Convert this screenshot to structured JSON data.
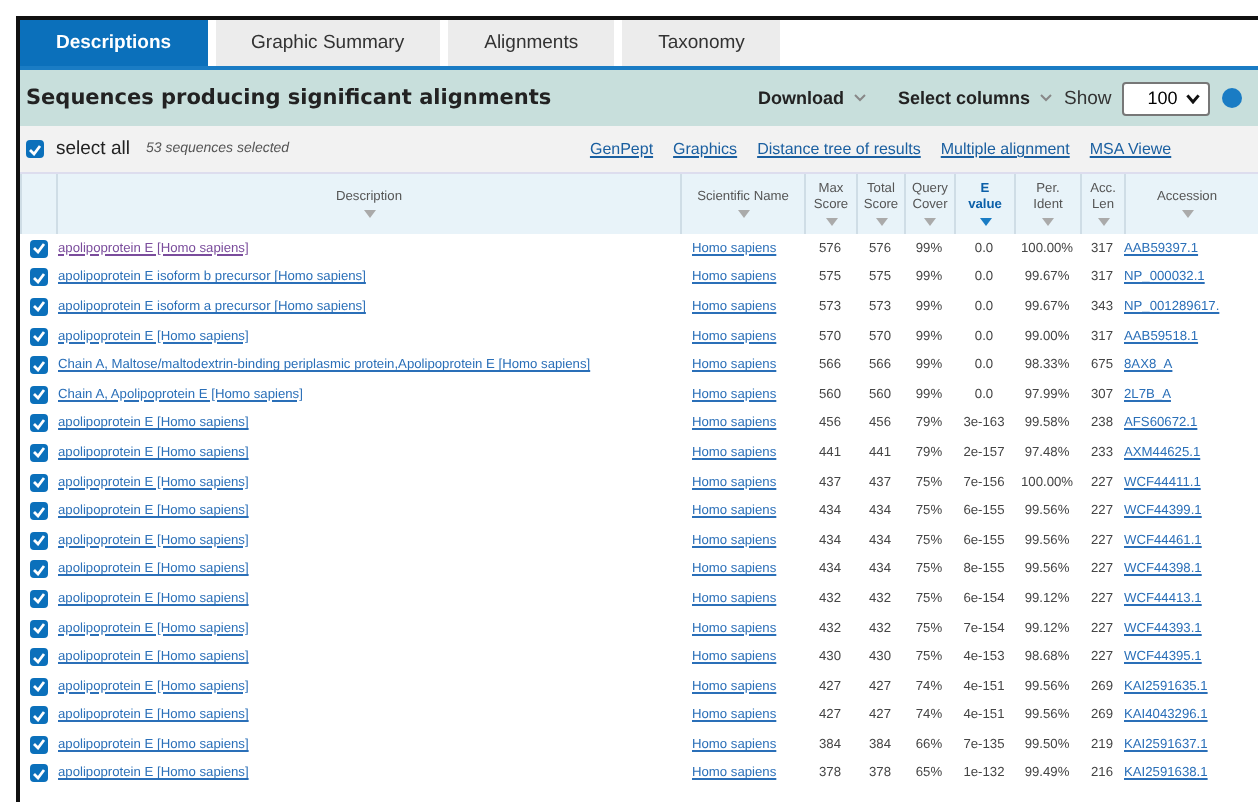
{
  "tabs": [
    {
      "label": "Descriptions",
      "selected": true
    },
    {
      "label": "Graphic Summary",
      "selected": false
    },
    {
      "label": "Alignments",
      "selected": false
    },
    {
      "label": "Taxonomy",
      "selected": false
    }
  ],
  "toolbar": {
    "title": "Sequences producing significant alignments",
    "download": "Download",
    "select_columns": "Select columns",
    "show_label": "Show",
    "show_value": "100"
  },
  "select_all": {
    "label": "select all",
    "checked": true,
    "count": "53 sequences selected"
  },
  "links": [
    "GenPept",
    "Graphics",
    "Distance tree of results",
    "Multiple alignment",
    "MSA Viewe"
  ],
  "columns": [
    {
      "label": "Description",
      "sorted": false
    },
    {
      "label": "Scientific Name",
      "sorted": false
    },
    {
      "label": "Max Score",
      "sorted": false
    },
    {
      "label": "Total Score",
      "sorted": false
    },
    {
      "label": "Query Cover",
      "sorted": false
    },
    {
      "label": "E value",
      "sorted": true
    },
    {
      "label": "Per. Ident",
      "sorted": false
    },
    {
      "label": "Acc. Len",
      "sorted": false
    },
    {
      "label": "Accession",
      "sorted": false
    }
  ],
  "rows": [
    {
      "checked": true,
      "visited": true,
      "description": "apolipoprotein E [Homo sapiens]",
      "scientific_name": "Homo sapiens",
      "max_score": "576",
      "total_score": "576",
      "query_cover": "99%",
      "e_value": "0.0",
      "per_ident": "100.00%",
      "acc_len": "317",
      "accession": "AAB59397.1"
    },
    {
      "checked": true,
      "visited": false,
      "description": "apolipoprotein E isoform b precursor [Homo sapiens]",
      "scientific_name": "Homo sapiens",
      "max_score": "575",
      "total_score": "575",
      "query_cover": "99%",
      "e_value": "0.0",
      "per_ident": "99.67%",
      "acc_len": "317",
      "accession": "NP_000032.1"
    },
    {
      "checked": true,
      "visited": false,
      "description": "apolipoprotein E isoform a precursor [Homo sapiens]",
      "scientific_name": "Homo sapiens",
      "max_score": "573",
      "total_score": "573",
      "query_cover": "99%",
      "e_value": "0.0",
      "per_ident": "99.67%",
      "acc_len": "343",
      "accession": "NP_001289617."
    },
    {
      "checked": true,
      "visited": false,
      "description": "apolipoprotein E [Homo sapiens]",
      "scientific_name": "Homo sapiens",
      "max_score": "570",
      "total_score": "570",
      "query_cover": "99%",
      "e_value": "0.0",
      "per_ident": "99.00%",
      "acc_len": "317",
      "accession": "AAB59518.1"
    },
    {
      "checked": true,
      "visited": false,
      "description": "Chain A, Maltose/maltodextrin-binding periplasmic protein,Apolipoprotein E [Homo sapiens]",
      "scientific_name": "Homo sapiens",
      "max_score": "566",
      "total_score": "566",
      "query_cover": "99%",
      "e_value": "0.0",
      "per_ident": "98.33%",
      "acc_len": "675",
      "accession": "8AX8_A"
    },
    {
      "checked": true,
      "visited": false,
      "description": "Chain A, Apolipoprotein E [Homo sapiens]",
      "scientific_name": "Homo sapiens",
      "max_score": "560",
      "total_score": "560",
      "query_cover": "99%",
      "e_value": "0.0",
      "per_ident": "97.99%",
      "acc_len": "307",
      "accession": "2L7B_A"
    },
    {
      "checked": true,
      "visited": false,
      "description": "apolipoprotein E [Homo sapiens]",
      "scientific_name": "Homo sapiens",
      "max_score": "456",
      "total_score": "456",
      "query_cover": "79%",
      "e_value": "3e-163",
      "per_ident": "99.58%",
      "acc_len": "238",
      "accession": "AFS60672.1"
    },
    {
      "checked": true,
      "visited": false,
      "description": "apolipoprotein E [Homo sapiens]",
      "scientific_name": "Homo sapiens",
      "max_score": "441",
      "total_score": "441",
      "query_cover": "79%",
      "e_value": "2e-157",
      "per_ident": "97.48%",
      "acc_len": "233",
      "accession": "AXM44625.1"
    },
    {
      "checked": true,
      "visited": false,
      "description": "apolipoprotein E [Homo sapiens]",
      "scientific_name": "Homo sapiens",
      "max_score": "437",
      "total_score": "437",
      "query_cover": "75%",
      "e_value": "7e-156",
      "per_ident": "100.00%",
      "acc_len": "227",
      "accession": "WCF44411.1"
    },
    {
      "checked": true,
      "visited": false,
      "description": "apolipoprotein E [Homo sapiens]",
      "scientific_name": "Homo sapiens",
      "max_score": "434",
      "total_score": "434",
      "query_cover": "75%",
      "e_value": "6e-155",
      "per_ident": "99.56%",
      "acc_len": "227",
      "accession": "WCF44399.1"
    },
    {
      "checked": true,
      "visited": false,
      "description": "apolipoprotein E [Homo sapiens]",
      "scientific_name": "Homo sapiens",
      "max_score": "434",
      "total_score": "434",
      "query_cover": "75%",
      "e_value": "6e-155",
      "per_ident": "99.56%",
      "acc_len": "227",
      "accession": "WCF44461.1"
    },
    {
      "checked": true,
      "visited": false,
      "description": "apolipoprotein E [Homo sapiens]",
      "scientific_name": "Homo sapiens",
      "max_score": "434",
      "total_score": "434",
      "query_cover": "75%",
      "e_value": "8e-155",
      "per_ident": "99.56%",
      "acc_len": "227",
      "accession": "WCF44398.1"
    },
    {
      "checked": true,
      "visited": false,
      "description": "apolipoprotein E [Homo sapiens]",
      "scientific_name": "Homo sapiens",
      "max_score": "432",
      "total_score": "432",
      "query_cover": "75%",
      "e_value": "6e-154",
      "per_ident": "99.12%",
      "acc_len": "227",
      "accession": "WCF44413.1"
    },
    {
      "checked": true,
      "visited": false,
      "description": "apolipoprotein E [Homo sapiens]",
      "scientific_name": "Homo sapiens",
      "max_score": "432",
      "total_score": "432",
      "query_cover": "75%",
      "e_value": "7e-154",
      "per_ident": "99.12%",
      "acc_len": "227",
      "accession": "WCF44393.1"
    },
    {
      "checked": true,
      "visited": false,
      "description": "apolipoprotein E [Homo sapiens]",
      "scientific_name": "Homo sapiens",
      "max_score": "430",
      "total_score": "430",
      "query_cover": "75%",
      "e_value": "4e-153",
      "per_ident": "98.68%",
      "acc_len": "227",
      "accession": "WCF44395.1"
    },
    {
      "checked": true,
      "visited": false,
      "description": "apolipoprotein E [Homo sapiens]",
      "scientific_name": "Homo sapiens",
      "max_score": "427",
      "total_score": "427",
      "query_cover": "74%",
      "e_value": "4e-151",
      "per_ident": "99.56%",
      "acc_len": "269",
      "accession": "KAI2591635.1"
    },
    {
      "checked": true,
      "visited": false,
      "description": "apolipoprotein E [Homo sapiens]",
      "scientific_name": "Homo sapiens",
      "max_score": "427",
      "total_score": "427",
      "query_cover": "74%",
      "e_value": "4e-151",
      "per_ident": "99.56%",
      "acc_len": "269",
      "accession": "KAI4043296.1"
    },
    {
      "checked": true,
      "visited": false,
      "description": "apolipoprotein E [Homo sapiens]",
      "scientific_name": "Homo sapiens",
      "max_score": "384",
      "total_score": "384",
      "query_cover": "66%",
      "e_value": "7e-135",
      "per_ident": "99.50%",
      "acc_len": "219",
      "accession": "KAI2591637.1"
    },
    {
      "checked": true,
      "visited": false,
      "description": "apolipoprotein E [Homo sapiens]",
      "scientific_name": "Homo sapiens",
      "max_score": "378",
      "total_score": "378",
      "query_cover": "65%",
      "e_value": "1e-132",
      "per_ident": "99.49%",
      "acc_len": "216",
      "accession": "KAI2591638.1"
    }
  ]
}
